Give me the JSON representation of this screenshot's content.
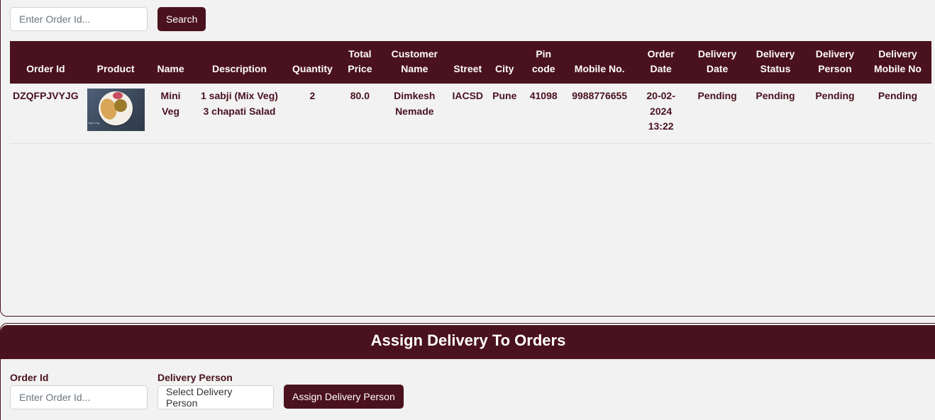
{
  "search": {
    "placeholder": "Enter Order Id...",
    "button_label": "Search"
  },
  "table": {
    "headers": [
      [
        "Order Id"
      ],
      [
        "Product"
      ],
      [
        "Name"
      ],
      [
        "Description"
      ],
      [
        "Quantity"
      ],
      [
        "Total",
        "Price"
      ],
      [
        "Customer",
        "Name"
      ],
      [
        "Street"
      ],
      [
        "City"
      ],
      [
        "Pin",
        "code"
      ],
      [
        "Mobile No."
      ],
      [
        "Order",
        "Date"
      ],
      [
        "Delivery",
        "Date"
      ],
      [
        "Delivery",
        "Status"
      ],
      [
        "Delivery",
        "Person"
      ],
      [
        "Delivery",
        "Mobile No"
      ]
    ],
    "rows": [
      {
        "order_id": "DZQFPJVYJG",
        "product_image": "food-thali-image",
        "product_image_caption": "Mini Veg",
        "name": [
          "Mini",
          "Veg"
        ],
        "description": [
          "1 sabji (Mix Veg)",
          "3 chapati Salad"
        ],
        "quantity": "2",
        "total_price": "80.0",
        "customer_name": [
          "Dimkesh",
          "Nemade"
        ],
        "street": "IACSD",
        "city": "Pune",
        "pin_code": "41098",
        "mobile": "9988776655",
        "order_date": [
          "20-02-",
          "2024",
          "13:22"
        ],
        "delivery_date": "Pending",
        "delivery_status": "Pending",
        "delivery_person": "Pending",
        "delivery_mobile": "Pending"
      }
    ]
  },
  "assign": {
    "title": "Assign Delivery To Orders",
    "order_id_label": "Order Id",
    "order_id_placeholder": "Enter Order Id...",
    "delivery_person_label": "Delivery Person",
    "delivery_person_selected": "Select Delivery Person",
    "button_label": "Assign Delivery Person"
  },
  "colors": {
    "brand": "#4a111e",
    "background": "#f1f2f1",
    "white": "#ffffff"
  }
}
